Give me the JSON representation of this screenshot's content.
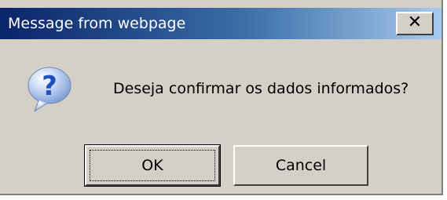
{
  "window": {
    "title": "Message from webpage",
    "close_label": "✕"
  },
  "dialog": {
    "icon": "question-icon",
    "message": "Deseja confirmar os dados informados?"
  },
  "buttons": {
    "ok_label": "OK",
    "cancel_label": "Cancel"
  },
  "colors": {
    "titlebar_start": "#0a246a",
    "titlebar_end": "#a6caf0",
    "dialog_bg": "#d4d0c8",
    "icon_blue": "#3a6fd8"
  }
}
